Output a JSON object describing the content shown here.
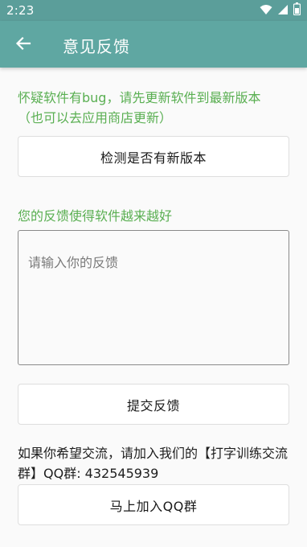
{
  "status_bar": {
    "time": "2:23",
    "icons": [
      "wifi-icon",
      "signal-icon",
      "battery-icon"
    ]
  },
  "app_bar": {
    "title": "意见反馈",
    "back_icon": "arrow-left-icon"
  },
  "update_hint": {
    "line1": "怀疑软件有bug，请先更新软件到最新版本",
    "line2": "（也可以去应用商店更新）"
  },
  "check_button_label": "检测是否有新版本",
  "feedback": {
    "label": "您的反馈使得软件越来越好",
    "placeholder": "请输入你的反馈",
    "value": ""
  },
  "submit_button_label": "提交反馈",
  "qq": {
    "text": "如果你希望交流，请加入我们的【打字训练交流群】QQ群: 432545939"
  },
  "join_button_label": "马上加入QQ群",
  "colors": {
    "app_bar": "#5fa7a2",
    "status_bar": "#5b9e9a",
    "accent_green": "#5aaf52",
    "background": "#fafafa"
  }
}
